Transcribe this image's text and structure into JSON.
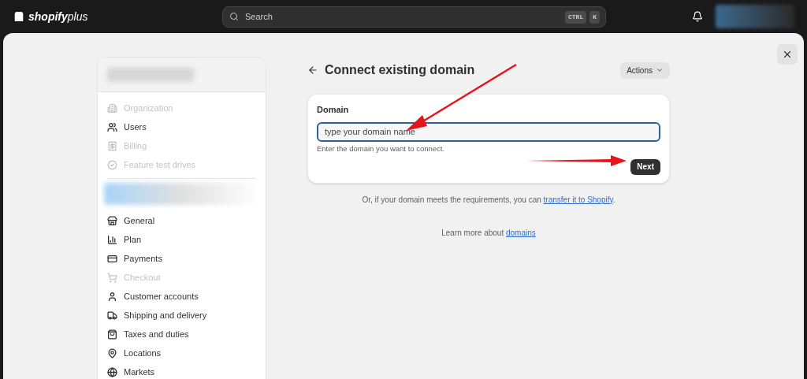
{
  "topbar": {
    "logo": {
      "brand": "shopify",
      "suffix": "plus"
    },
    "search": {
      "placeholder": "Search",
      "shortcut": [
        "CTRL",
        "K"
      ]
    }
  },
  "sidebar": {
    "org_items": [
      {
        "label": "Organization",
        "disabled": true
      },
      {
        "label": "Users",
        "disabled": false
      },
      {
        "label": "Billing",
        "disabled": true
      },
      {
        "label": "Feature test drives",
        "disabled": true
      }
    ],
    "store_items": [
      {
        "label": "General",
        "disabled": false
      },
      {
        "label": "Plan",
        "disabled": false
      },
      {
        "label": "Payments",
        "disabled": false
      },
      {
        "label": "Checkout",
        "disabled": true
      },
      {
        "label": "Customer accounts",
        "disabled": false
      },
      {
        "label": "Shipping and delivery",
        "disabled": false
      },
      {
        "label": "Taxes and duties",
        "disabled": false
      },
      {
        "label": "Locations",
        "disabled": false
      },
      {
        "label": "Markets",
        "disabled": false
      }
    ]
  },
  "page": {
    "title": "Connect existing domain",
    "actions": "Actions",
    "domain_card": {
      "label": "Domain",
      "value": "type your domain name",
      "help": "Enter the domain you want to connect.",
      "button": "Next"
    },
    "transfer_note": {
      "text": "Or, if your domain meets the requirements, you can ",
      "link": "transfer it to Shopify",
      "after": "."
    },
    "learn_more": {
      "text": "Learn more about ",
      "link": "domains"
    }
  }
}
